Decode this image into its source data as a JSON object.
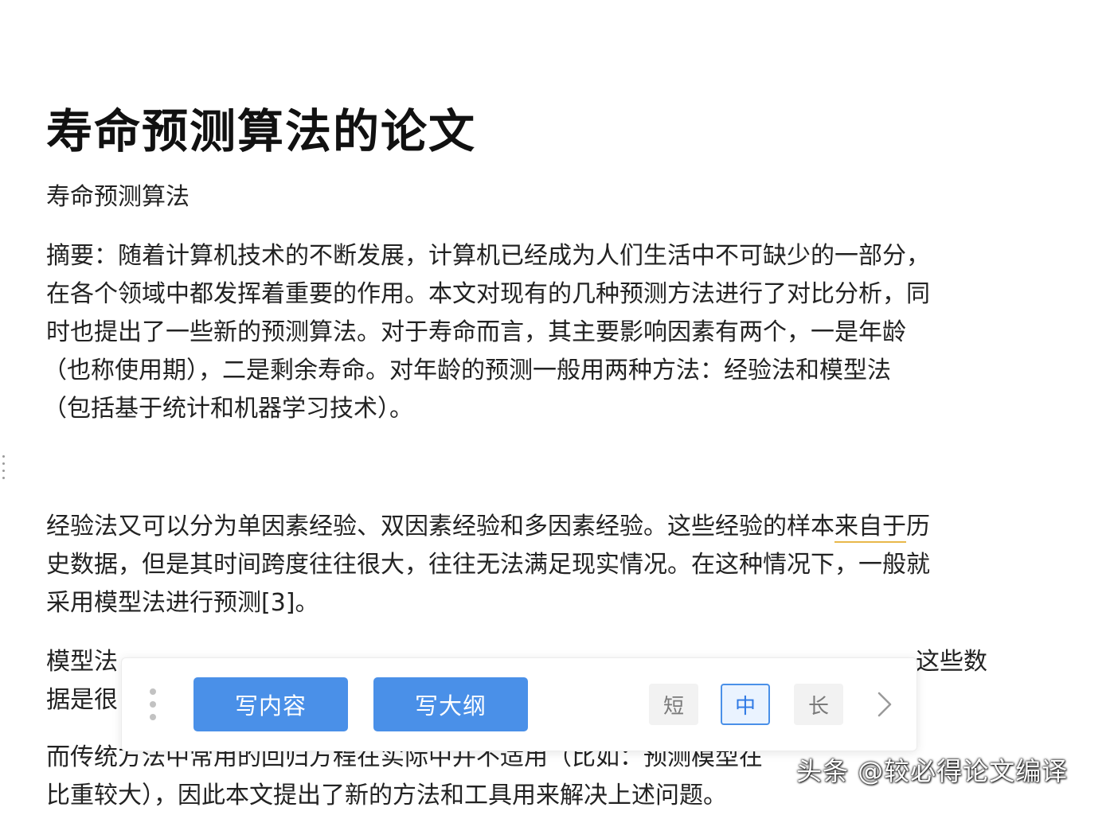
{
  "document": {
    "title": "寿命预测算法的论文",
    "subtitle": "寿命预测算法",
    "paragraphs": [
      {
        "lines": [
          "摘要：随着计算机技术的不断发展，计算机已经成为人们生活中不可缺少的一部分，",
          "在各个领域中都发挥着重要的作用。本文对现有的几种预测方法进行了对比分析，同",
          "时也提出了一些新的预测算法。对于寿命而言，其主要影响因素有两个，一是年龄",
          "（也称使用期），二是剩余寿命。对年龄的预测一般用两种方法：经验法和模型法",
          "（包括基于统计和机器学习技术）。"
        ]
      },
      {
        "line1_before": "经验法又可以分为单因素经验、双因素经验和多因素经验。这些经验的样本",
        "line1_underlined": "来自于",
        "line1_after": "历",
        "lines": [
          "史数据，但是其时间跨度往往很大，往往无法满足现实情况。在这种情况下，一般就",
          "采用模型法进行预测[3]。"
        ]
      },
      {
        "line1_left": "模型法",
        "line1_right": "这些数",
        "line2_left": "据是很"
      },
      {
        "lines": [
          "而传统方法中常用的回归方程在实际中并不适用（比如：预测模型在",
          "比重较大），因此本文提出了新的方法和工具用来解决上述问题。"
        ]
      }
    ]
  },
  "toolbar": {
    "write_content_label": "写内容",
    "write_outline_label": "写大纲",
    "length_options": [
      "短",
      "中",
      "长"
    ],
    "selected_length": "中",
    "next_icon": "chevron-right-icon",
    "accent_color": "#4a90e8"
  },
  "watermark": {
    "text": "头条 @较必得论文编译"
  },
  "colors": {
    "text": "#222222",
    "underline": "#e8b84a",
    "primary_button": "#4a90e8"
  }
}
